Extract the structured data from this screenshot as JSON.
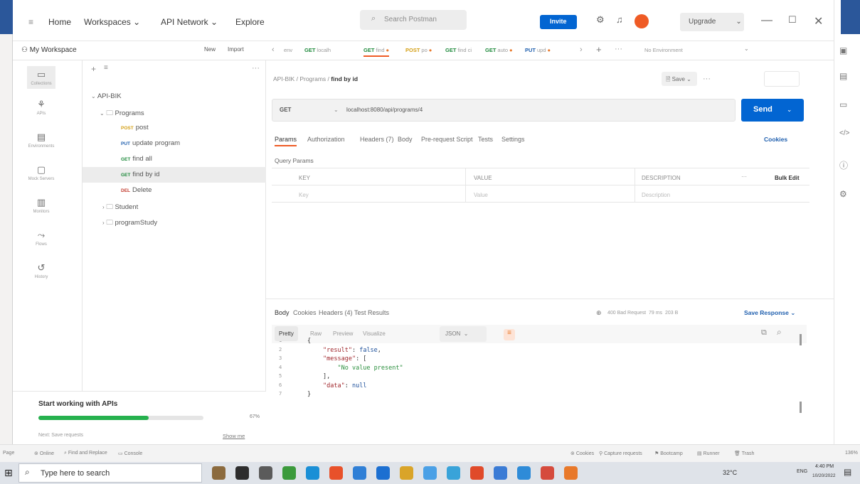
{
  "nav": {
    "home": "Home",
    "workspaces": "Workspaces",
    "api_network": "API Network",
    "explore": "Explore"
  },
  "search": {
    "placeholder": "Search Postman"
  },
  "invite": "Invite",
  "upgrade": "Upgrade",
  "environment": "No Environment",
  "tabs": [
    {
      "method": "",
      "label": "env"
    },
    {
      "method": "GET",
      "label": "localh"
    },
    {
      "method": "GET",
      "label": "find",
      "dirty": true
    },
    {
      "method": "POST",
      "label": "po",
      "dirty": true
    },
    {
      "method": "GET",
      "label": "find ci"
    },
    {
      "method": "GET",
      "label": "auto",
      "dirty": true
    },
    {
      "method": "PUT",
      "label": "upd",
      "dirty": true
    }
  ],
  "workspace": {
    "name": "My Workspace",
    "new": "New",
    "import": "Import"
  },
  "rail": [
    {
      "icon": "collections-icon",
      "label": "Collections"
    },
    {
      "icon": "apis-icon",
      "label": "APIs"
    },
    {
      "icon": "environments-icon",
      "label": "Environments"
    },
    {
      "icon": "mock-servers-icon",
      "label": "Mock Servers"
    },
    {
      "icon": "monitors-icon",
      "label": "Monitors"
    },
    {
      "icon": "flows-icon",
      "label": "Flows"
    },
    {
      "icon": "history-icon",
      "label": "History"
    }
  ],
  "tree": {
    "collection": "API-BIK",
    "programs": "Programs",
    "requests": [
      {
        "method": "POST",
        "label": "post"
      },
      {
        "method": "PUT",
        "label": "update program"
      },
      {
        "method": "GET",
        "label": "find all"
      },
      {
        "method": "GET",
        "label": "find by id"
      },
      {
        "method": "DEL",
        "label": "Delete"
      }
    ],
    "folders": [
      "Student",
      "programStudy"
    ]
  },
  "breadcrumb": {
    "parent": "API-BIK / Programs /",
    "current": "find by id"
  },
  "save": "Save",
  "request": {
    "method": "GET",
    "url": "localhost:8080/api/programs/4",
    "send": "Send"
  },
  "req_tabs": [
    "Params",
    "Authorization",
    "Headers (7)",
    "Body",
    "Pre-request Script",
    "Tests",
    "Settings"
  ],
  "cookies": "Cookies",
  "query_params": "Query Params",
  "params_table": {
    "headers": [
      "KEY",
      "VALUE",
      "DESCRIPTION"
    ],
    "bulk_edit": "Bulk Edit",
    "placeholders": [
      "Key",
      "Value",
      "Description"
    ]
  },
  "resp_tabs": [
    "Body",
    "Cookies",
    "Headers (4)",
    "Test Results"
  ],
  "status": {
    "code": "400 Bad Request",
    "time": "79 ms",
    "size": "203 B"
  },
  "save_response": "Save Response",
  "views": [
    "Pretty",
    "Raw",
    "Preview",
    "Visualize"
  ],
  "format": "JSON",
  "code_lines": [
    {
      "n": "1",
      "parts": [
        [
          "p",
          "{"
        ]
      ]
    },
    {
      "n": "2",
      "parts": [
        [
          "k",
          "\"result\""
        ],
        [
          "p",
          ": "
        ],
        [
          "v",
          "false"
        ],
        [
          "p",
          ","
        ]
      ]
    },
    {
      "n": "3",
      "parts": [
        [
          "k",
          "\"message\""
        ],
        [
          "p",
          ": ["
        ]
      ]
    },
    {
      "n": "4",
      "parts": [
        [
          "p",
          "    "
        ],
        [
          "s",
          "\"No value present\""
        ]
      ]
    },
    {
      "n": "5",
      "parts": [
        [
          "p",
          "],"
        ]
      ]
    },
    {
      "n": "6",
      "parts": [
        [
          "k",
          "\"data\""
        ],
        [
          "p",
          ": "
        ],
        [
          "v",
          "null"
        ]
      ]
    },
    {
      "n": "7",
      "parts": [
        [
          "p",
          "}"
        ]
      ]
    }
  ],
  "start_panel": {
    "title": "Start working with APIs",
    "percent": "67%",
    "progress": 0.67,
    "next": "Next: Save requests",
    "show_me": "Show me"
  },
  "statusbar": {
    "page": "Page",
    "left": [
      "Online",
      "Find and Replace",
      "Console"
    ],
    "right": [
      "Cookies",
      "Capture requests",
      "Bootcamp",
      "Runner",
      "Trash"
    ],
    "zoom": "136%"
  },
  "taskbar": {
    "search": "Type here to search",
    "temp": "32°C",
    "lang": "ENG",
    "time": "4:40 PM",
    "date": "10/20/2022"
  }
}
